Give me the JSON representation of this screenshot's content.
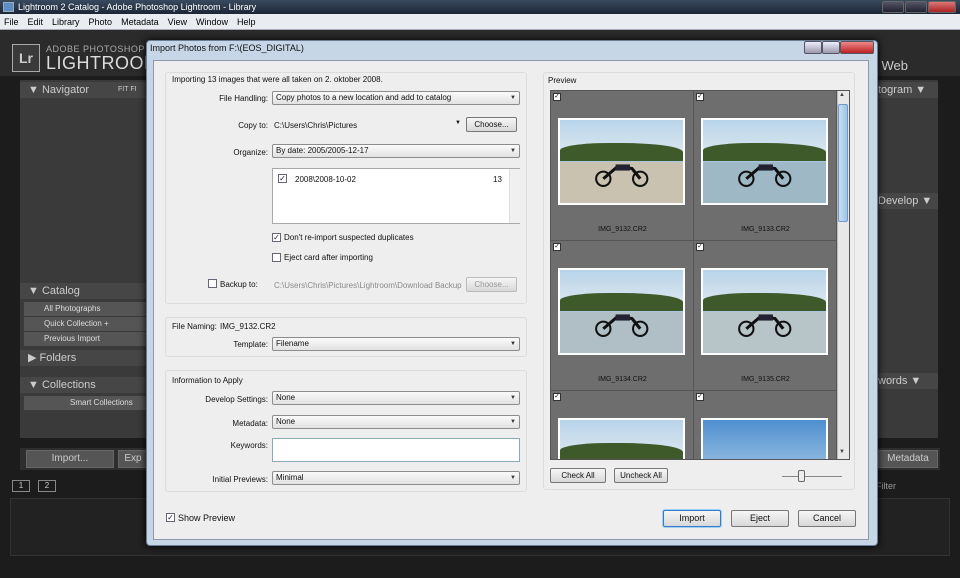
{
  "window": {
    "title": "Lightroom 2 Catalog - Adobe Photoshop Lightroom - Library",
    "menu": [
      "File",
      "Edit",
      "Library",
      "Photo",
      "Metadata",
      "View",
      "Window",
      "Help"
    ]
  },
  "lightroom": {
    "logo": "Lr",
    "brand_sub": "ADOBE PHOTOSHOP",
    "brand_name": "LIGHTROOM",
    "module_nav": "nt  |  Web",
    "left": {
      "navigator": "Navigator",
      "nav_fit": "FIT   FI",
      "catalog": "Catalog",
      "catalog_items": [
        "All Photographs",
        "Quick Collection  +",
        "Previous Import"
      ],
      "folders": "Folders",
      "collections": "Collections",
      "smart_collections": "Smart Collections"
    },
    "right": {
      "histogram": "togram",
      "develop": "Develop",
      "wording": "words",
      "keywords_short": "ords",
      "metadata": "Metadata"
    },
    "bottom": {
      "import_btn": "Import...",
      "export_btn": "Exp",
      "filter": "Filter",
      "page1": "1",
      "page2": "2"
    }
  },
  "dialog": {
    "title": "Import Photos from F:\\(EOS_DIGITAL)",
    "summary": "Importing 13 images that were all taken on 2. oktober 2008.",
    "file_handling": {
      "label": "File Handling:",
      "value": "Copy photos to a new location and add to catalog"
    },
    "copy_to": {
      "label": "Copy to:",
      "value": "C:\\Users\\Chris\\Pictures",
      "button": "Choose..."
    },
    "organize": {
      "label": "Organize:",
      "value": "By date: 2005/2005-12-17"
    },
    "folder_list": [
      {
        "name": "2008\\2008-10-02",
        "count": "13",
        "checked": true
      }
    ],
    "dont_reimport": {
      "label": "Don't re-import suspected duplicates",
      "checked": true
    },
    "eject_card": {
      "label": "Eject card after importing",
      "checked": false
    },
    "backup": {
      "label": "Backup to:",
      "value": "C:\\Users\\Chris\\Pictures\\Lightroom\\Download Backup",
      "button": "Choose..."
    },
    "file_naming": {
      "label": "File Naming:",
      "example": "IMG_9132.CR2"
    },
    "template": {
      "label": "Template:",
      "value": "Filename"
    },
    "info_section": "Information to Apply",
    "develop_settings": {
      "label": "Develop Settings:",
      "value": "None"
    },
    "metadata": {
      "label": "Metadata:",
      "value": "None"
    },
    "keywords": {
      "label": "Keywords:",
      "value": ""
    },
    "initial_previews": {
      "label": "Initial Previews:",
      "value": "Minimal"
    },
    "show_preview": {
      "label": "Show Preview",
      "checked": true
    },
    "preview_title": "Preview",
    "thumbnails": [
      "IMG_9132.CR2",
      "IMG_9133.CR2",
      "IMG_9134.CR2",
      "IMG_9135.CR2",
      "",
      ""
    ],
    "check_all": "Check All",
    "uncheck_all": "Uncheck All",
    "import_btn": "Import",
    "eject_btn": "Eject",
    "cancel_btn": "Cancel"
  }
}
